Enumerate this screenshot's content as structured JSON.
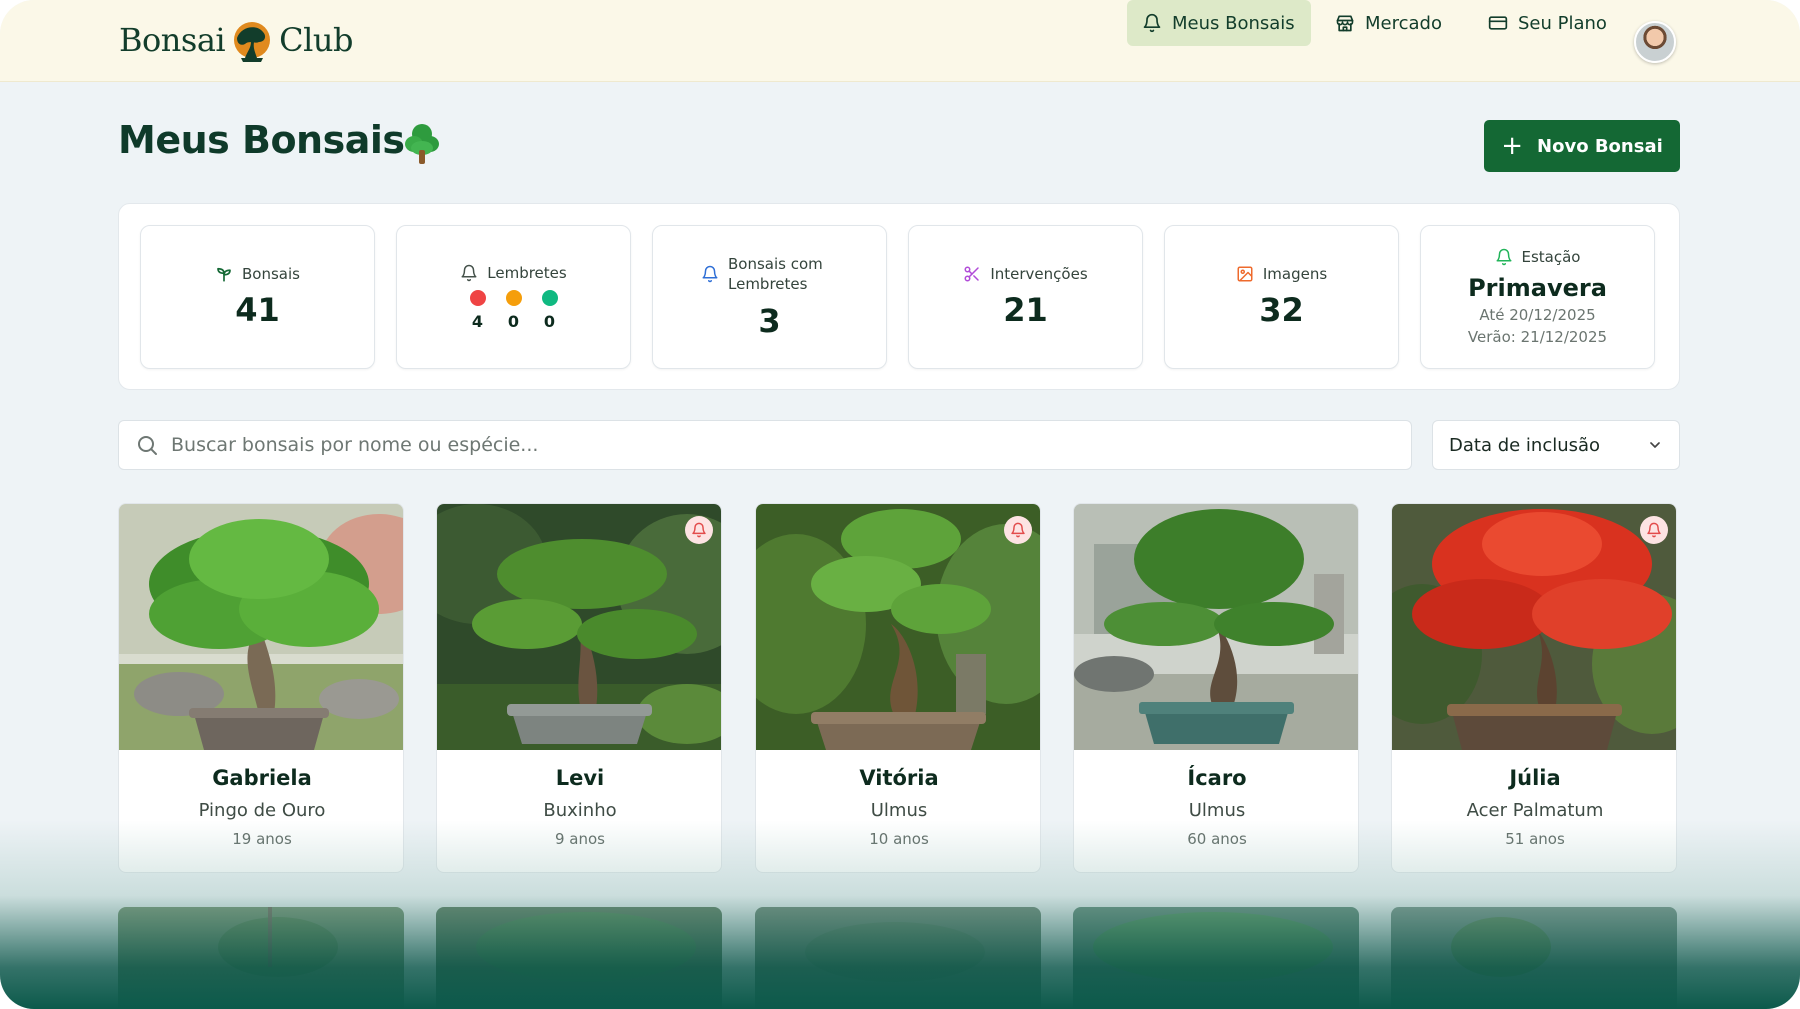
{
  "app": {
    "logo_left": "Bonsai",
    "logo_right": "Club"
  },
  "nav": {
    "items": [
      {
        "label": "Meus Bonsais",
        "icon": "bell-icon",
        "active": true
      },
      {
        "label": "Mercado",
        "icon": "store-icon",
        "active": false
      },
      {
        "label": "Seu Plano",
        "icon": "credit-card-icon",
        "active": false
      }
    ]
  },
  "page": {
    "title": "Meus Bonsais",
    "new_button": "Novo Bonsai"
  },
  "stats": {
    "bonsais": {
      "label": "Bonsais",
      "value": "41",
      "icon": "sprout-icon"
    },
    "lembretes": {
      "label": "Lembretes",
      "icon": "bell-icon",
      "dots": [
        {
          "color": "#ef4444",
          "value": "4"
        },
        {
          "color": "#f59e0b",
          "value": "0"
        },
        {
          "color": "#10b981",
          "value": "0"
        }
      ]
    },
    "com_lembretes": {
      "label": "Bonsais com Lembretes",
      "value": "3",
      "icon": "bell-icon"
    },
    "intervencoes": {
      "label": "Intervenções",
      "value": "21",
      "icon": "scissors-icon"
    },
    "imagens": {
      "label": "Imagens",
      "value": "32",
      "icon": "image-icon"
    },
    "estacao": {
      "label": "Estação",
      "value": "Primavera",
      "until": "Até 20/12/2025",
      "next": "Verão: 21/12/2025",
      "icon": "bell-icon"
    }
  },
  "search": {
    "placeholder": "Buscar bonsais por nome ou espécie...",
    "value": ""
  },
  "sort": {
    "selected": "Data de inclusão"
  },
  "bonsais": [
    {
      "name": "Gabriela",
      "species": "Pingo de Ouro",
      "age": "19 anos",
      "reminder": false
    },
    {
      "name": "Levi",
      "species": "Buxinho",
      "age": "9 anos",
      "reminder": true
    },
    {
      "name": "Vitória",
      "species": "Ulmus",
      "age": "10 anos",
      "reminder": true
    },
    {
      "name": "Ícaro",
      "species": "Ulmus",
      "age": "60 anos",
      "reminder": false
    },
    {
      "name": "Júlia",
      "species": "Acer Palmatum",
      "age": "51 anos",
      "reminder": true
    }
  ],
  "colors": {
    "brand_green": "#146834",
    "topbar": "#fbf8e8",
    "active_nav": "#dde9c8",
    "autumn_red": "#d9321f"
  }
}
